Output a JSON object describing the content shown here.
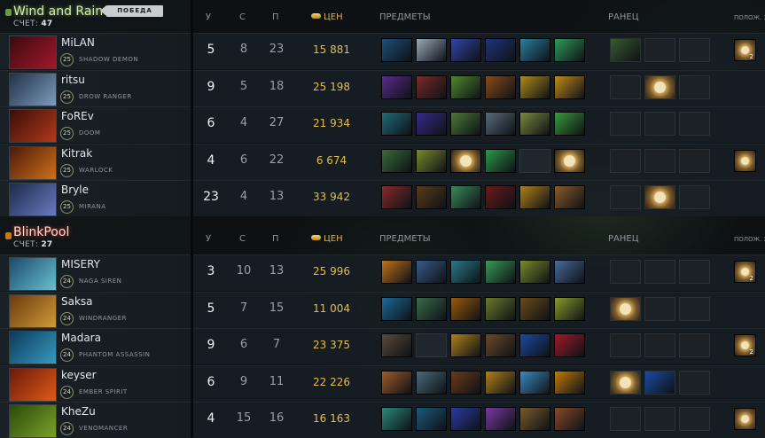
{
  "teams": [
    {
      "name": "Wind and Rain",
      "score_label": "СЧЕТ:",
      "score": "47",
      "victory_label": "ПОБЕДА",
      "columns": {
        "k": "У",
        "d": "С",
        "a": "П",
        "gold": "ЦЕН",
        "items": "ПРЕДМЕТЫ",
        "backpack": "РАНЕЦ",
        "neutral": "ПОЛОЖ. З"
      },
      "players": [
        {
          "name": "MiLAN",
          "level": "25",
          "hero": "SHADOW DEMON",
          "k": "5",
          "d": "8",
          "a": "23",
          "gold": "15 881",
          "portrait": [
            "#3a0b10",
            "#a1182a"
          ],
          "items": [
            "#1d4f7a",
            "#9aa9b5",
            "#3145a8",
            "#23337a",
            "#2a7fa0",
            "#2f9a5a"
          ],
          "backpack": [
            "#3a5a2f",
            null,
            null
          ],
          "neutral": {
            "count": "2"
          }
        },
        {
          "name": "ritsu",
          "level": "25",
          "hero": "DROW RANGER",
          "k": "9",
          "d": "5",
          "a": "18",
          "gold": "25 198",
          "portrait": [
            "#1f3147",
            "#7e9bbd"
          ],
          "items": [
            "#5a2a8a",
            "#7a2a2a",
            "#4f8a2a",
            "#8a4a1a",
            "#b08a1a",
            "#c08a1a"
          ],
          "backpack": [
            null,
            "scroll",
            null
          ],
          "neutral": null
        },
        {
          "name": "FoREv",
          "level": "25",
          "hero": "DOOM",
          "k": "6",
          "d": "4",
          "a": "27",
          "gold": "21 934",
          "portrait": [
            "#3a0d0a",
            "#b03a1a"
          ],
          "items": [
            "#1f6a7a",
            "#3a2a8a",
            "#4a7a3a",
            "#5a6a7a",
            "#7a8a3a",
            "#3a9a3a"
          ],
          "backpack": [
            null,
            null,
            null
          ],
          "neutral": null
        },
        {
          "name": "Kitrak",
          "level": "25",
          "hero": "WARLOCK",
          "k": "4",
          "d": "6",
          "a": "22",
          "gold": "6 674",
          "portrait": [
            "#4a1a0a",
            "#d0701a"
          ],
          "items": [
            "#3a6a3a",
            "#7a8a2a",
            "scroll",
            "#2a9a4a",
            null,
            "scroll"
          ],
          "backpack": [
            null,
            null,
            null
          ],
          "neutral": {
            "count": ""
          }
        },
        {
          "name": "Bryle",
          "level": "25",
          "hero": "MIRANA",
          "k": "23",
          "d": "4",
          "a": "13",
          "gold": "33 942",
          "portrait": [
            "#1a2a4a",
            "#6a7ac0"
          ],
          "items": [
            "#8a2a2a",
            "#5a3a1a",
            "#3a8a5a",
            "#6a1a1a",
            "#b0801a",
            "#8a5a2a"
          ],
          "backpack": [
            null,
            "scroll",
            null
          ],
          "neutral": null
        }
      ]
    },
    {
      "name": "BlinkPool",
      "score_label": "СЧЕТ:",
      "score": "27",
      "columns": {
        "k": "У",
        "d": "С",
        "a": "П",
        "gold": "ЦЕН",
        "items": "ПРЕДМЕТЫ",
        "backpack": "РАНЕЦ",
        "neutral": "ПОЛОЖ. З"
      },
      "players": [
        {
          "name": "MISERY",
          "level": "24",
          "hero": "NAGA SIREN",
          "k": "3",
          "d": "10",
          "a": "13",
          "gold": "25 996",
          "portrait": [
            "#1a4a6a",
            "#6ac0d0"
          ],
          "items": [
            "#c0701a",
            "#3a5a8a",
            "#2a7a8a",
            "#3a9a5a",
            "#7a8a2a",
            "#4a6a9a"
          ],
          "backpack": [
            null,
            null,
            null
          ],
          "neutral": {
            "count": "2"
          }
        },
        {
          "name": "Saksa",
          "level": "24",
          "hero": "WINDRANGER",
          "k": "5",
          "d": "7",
          "a": "15",
          "gold": "11 004",
          "portrait": [
            "#6a3a0a",
            "#d09a3a"
          ],
          "items": [
            "#1a6a9a",
            "#3a6a4a",
            "#9a5a0a",
            "#6a7a2a",
            "#6a4a1a",
            "#8a9a2a"
          ],
          "backpack": [
            "scroll",
            null,
            null
          ],
          "neutral": null
        },
        {
          "name": "Madara",
          "level": "24",
          "hero": "PHANTOM ASSASSIN",
          "k": "9",
          "d": "6",
          "a": "7",
          "gold": "23 375",
          "portrait": [
            "#0a3a5a",
            "#3a9ac0"
          ],
          "items": [
            "#5a4a3a",
            null,
            "#b0801a",
            "#6a4a2a",
            "#1a4aa0",
            "#a01a2a"
          ],
          "backpack": [
            null,
            null,
            null
          ],
          "neutral": {
            "count": "2"
          }
        },
        {
          "name": "keyser",
          "level": "24",
          "hero": "EMBER SPIRIT",
          "k": "6",
          "d": "9",
          "a": "11",
          "gold": "22 226",
          "portrait": [
            "#6a1a0a",
            "#e05a1a"
          ],
          "items": [
            "#a05a2a",
            "#4a6a7a",
            "#6a3a1a",
            "#b0801a",
            "#3a8ac0",
            "#c07a0a"
          ],
          "backpack": [
            "scroll",
            "#1a4aa0",
            null
          ],
          "neutral": null
        },
        {
          "name": "KheZu",
          "level": "24",
          "hero": "VENOMANCER",
          "k": "4",
          "d": "15",
          "a": "16",
          "gold": "16 163",
          "portrait": [
            "#2a4a0a",
            "#7aa02a"
          ],
          "items": [
            "#2a8a7a",
            "#1a5a7a",
            "#2a3aa0",
            "#7a3aa0",
            "#7a5a2a",
            "#8a4a2a"
          ],
          "backpack": [
            null,
            null,
            null
          ],
          "neutral": {
            "count": ""
          }
        }
      ]
    }
  ]
}
